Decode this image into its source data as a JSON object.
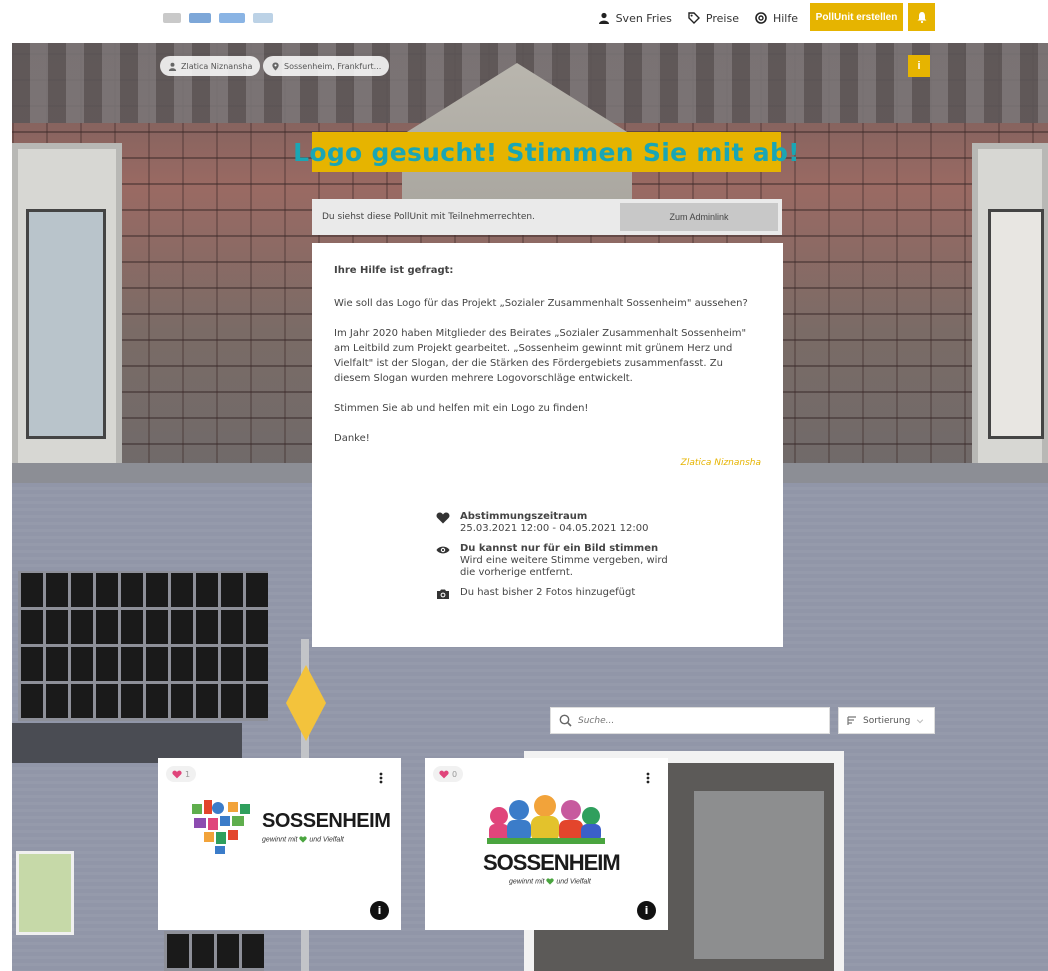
{
  "nav": {
    "user": "Sven Fries",
    "prices": "Preise",
    "help": "Hilfe",
    "create_button": "PollUnit erstellen"
  },
  "hero": {
    "creator_pill": "Zlatica Niznansha",
    "location_pill": "Sossenheim, Frankfurt...",
    "info_button": "i"
  },
  "poll": {
    "title": "Logo gesucht! Stimmen Sie mit ab!",
    "rights_text": "Du siehst diese PollUnit mit Teilnehmerrechten.",
    "admin_link": "Zum Adminlink"
  },
  "description": {
    "heading": "Ihre Hilfe ist gefragt:",
    "paragraph1": "Wie soll das Logo für das Projekt „Sozialer Zusammenhalt Sossenheim\" aussehen?",
    "paragraph2": "Im Jahr 2020 haben Mitglieder des Beirates „Sozialer Zusammenhalt Sossenheim\" am Leitbild zum Projekt gearbeitet. „Sossenheim gewinnt mit grünem Herz und Vielfalt\" ist der Slogan, der die Stärken des Fördergebiets zusammenfasst. Zu diesem Slogan wurden mehrere Logovorschläge entwickelt.",
    "paragraph3": "Stimmen Sie ab und helfen mit ein Logo zu finden!",
    "paragraph4": "Danke!",
    "author": "Zlatica Niznansha"
  },
  "meta": {
    "period_label": "Abstimmungszeitraum",
    "period_value": "25.03.2021 12:00 - 04.05.2021 12:00",
    "vote_rule_label": "Du kannst nur für ein Bild stimmen",
    "vote_rule_detail": "Wird eine weitere Stimme vergeben, wird die vorherige entfernt.",
    "photos_added": "Du hast bisher 2 Fotos hinzugefügt"
  },
  "toolbar": {
    "search_placeholder": "Suche...",
    "sort_label": "Sortierung"
  },
  "photos": [
    {
      "likes": "1",
      "logo_text": "SOSSENHEIM",
      "slogan": "gewinnt mit",
      "slogan_end": "und Vielfalt"
    },
    {
      "likes": "0",
      "logo_text": "SOSSENHEIM",
      "slogan": "gewinnt mit",
      "slogan_end": "und Vielfalt"
    }
  ],
  "colors": {
    "accent": "#e6b400",
    "title_text": "#1aa6b4",
    "like_heart": "#e0457b"
  }
}
